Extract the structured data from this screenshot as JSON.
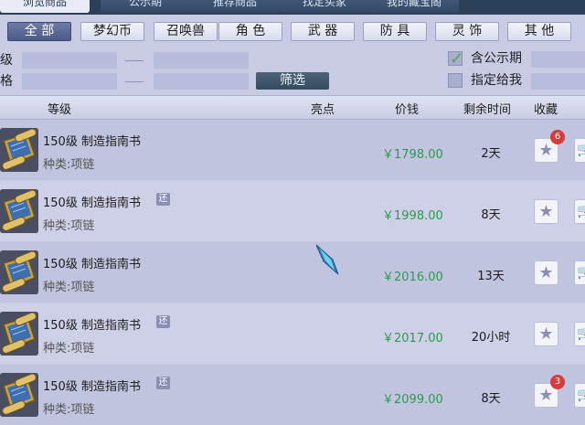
{
  "tabs": [
    {
      "label": "浏览商品",
      "active": true
    },
    {
      "label": "公示期",
      "active": false
    },
    {
      "label": "推荐商品",
      "active": false
    },
    {
      "label": "找定买家",
      "active": false
    },
    {
      "label": "我的藏宝阁",
      "active": false
    }
  ],
  "categories": [
    {
      "label": "全 部",
      "active": true
    },
    {
      "label": "梦幻币"
    },
    {
      "label": "召唤兽"
    },
    {
      "label": "角 色"
    },
    {
      "label": "武 器"
    },
    {
      "label": "防 具"
    },
    {
      "label": "灵 饰"
    },
    {
      "label": "其 他"
    }
  ],
  "filters": {
    "row1_label": "级",
    "row2_label": "格",
    "search_button": "筛选",
    "include_public_label": "含公示期",
    "include_public_checked": true,
    "assigned_to_me_label": "指定给我",
    "assigned_to_me_checked": false
  },
  "columns": {
    "level": "等级",
    "highlight": "亮点",
    "price": "价钱",
    "remaining": "剩余时间",
    "favorite": "收藏"
  },
  "items": [
    {
      "name": "150级  制造指南书",
      "bargain": "",
      "kind": "种类:项链",
      "price": "￥1798.00",
      "time": "2天",
      "fav_count": "6"
    },
    {
      "name": "150级  制造指南书",
      "bargain": "还",
      "kind": "种类:项链",
      "price": "￥1998.00",
      "time": "8天",
      "fav_count": ""
    },
    {
      "name": "150级  制造指南书",
      "bargain": "",
      "kind": "种类:项链",
      "price": "￥2016.00",
      "time": "13天",
      "fav_count": ""
    },
    {
      "name": "150级  制造指南书",
      "bargain": "还",
      "kind": "种类:项链",
      "price": "￥2017.00",
      "time": "20小时",
      "fav_count": ""
    },
    {
      "name": "150级  制造指南书",
      "bargain": "还",
      "kind": "种类:项链",
      "price": "￥2099.00",
      "time": "8天",
      "fav_count": "3"
    }
  ],
  "icons": {
    "thumbnail": "scroll-book-icon",
    "favorite": "star-icon",
    "cart": "cart-icon",
    "cursor": "feather-cursor-icon"
  },
  "colors": {
    "price": "#2f9a4e",
    "active_category": "#4c5a86",
    "badge_red": "#d83b3b"
  }
}
